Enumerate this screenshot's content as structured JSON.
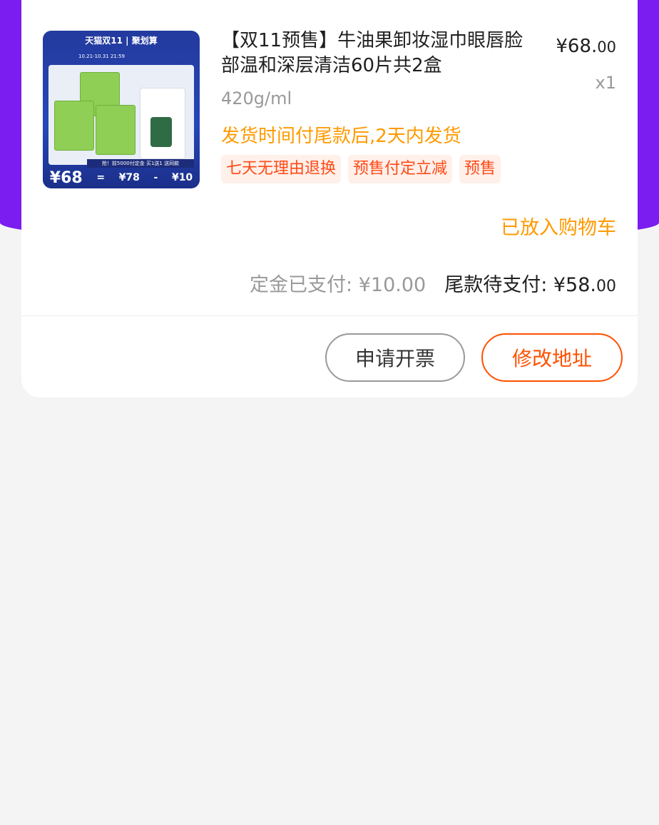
{
  "product": {
    "image_alt": "牛油果卸妆湿巾 product image",
    "image_text": {
      "brand_bar": "天猫双11 | 聚划算",
      "dates": "10.21-10.31 21:59",
      "strip": "抢！前5000付定金 买1送1 送同款",
      "price_big": "¥68",
      "eq": "=",
      "price_mid": "¥78",
      "minus": "-",
      "price_small": "¥10"
    },
    "title": "【双11预售】牛油果卸妆湿巾眼唇脸部温和深层清洁60片共2盒",
    "price_main": "¥68.",
    "price_decimal": "00",
    "quantity": "x1",
    "spec": "420g/ml",
    "shipping": "发货时间付尾款后,2天内发货",
    "tags": [
      "七天无理由退换",
      "预售付定立减",
      "预售"
    ],
    "cart_status": "已放入购物车"
  },
  "payment": {
    "deposit_label": "定金已支付: ¥10.00",
    "balance_label": "尾款待支付: ¥58.",
    "balance_decimal": "00"
  },
  "actions": {
    "invoice": "申请开票",
    "change_address": "修改地址"
  },
  "colors": {
    "header_purple": "#7b1cf0",
    "accent_orange": "#ff9a00",
    "action_red": "#ff5000",
    "tag_red": "#ff4a16"
  }
}
